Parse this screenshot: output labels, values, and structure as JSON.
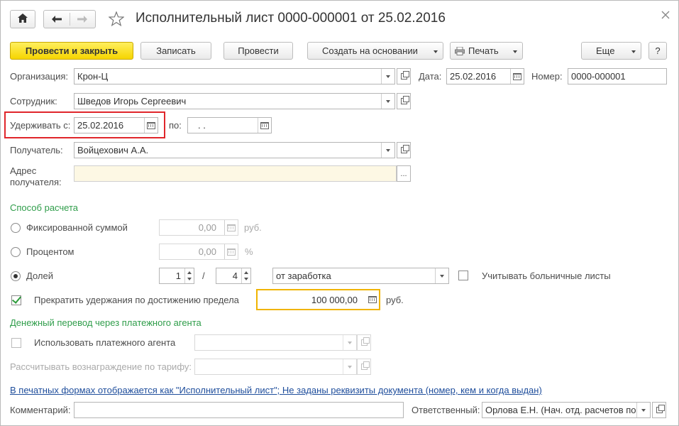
{
  "window": {
    "title": "Исполнительный лист 0000-000001 от 25.02.2016"
  },
  "toolbar": {
    "post_close": "Провести и закрыть",
    "save": "Записать",
    "post": "Провести",
    "create_based": "Создать на основании",
    "print": "Печать",
    "more": "Еще",
    "help": "?"
  },
  "form": {
    "organization": {
      "label": "Организация:",
      "value": "Крон-Ц"
    },
    "date": {
      "label": "Дата:",
      "value": "25.02.2016"
    },
    "number": {
      "label": "Номер:",
      "value": "0000-000001"
    },
    "employee": {
      "label": "Сотрудник:",
      "value": "Шведов Игорь Сергеевич"
    },
    "withhold_from": {
      "label": "Удерживать с:",
      "value": "25.02.2016"
    },
    "withhold_to": {
      "label": "по:",
      "value": " .  ."
    },
    "recipient": {
      "label": "Получатель:",
      "value": "Войцехович А.А."
    },
    "recipient_address": {
      "label_line1": "Адрес",
      "label_line2": "получателя:",
      "value": "",
      "button": "..."
    }
  },
  "calc": {
    "section_title": "Способ расчета",
    "fixed": {
      "label": "Фиксированной суммой",
      "value": "0,00",
      "unit": "руб.",
      "selected": false
    },
    "percent": {
      "label": "Процентом",
      "value": "0,00",
      "unit": "%",
      "selected": false
    },
    "share": {
      "label": "Долей",
      "numerator": "1",
      "separator": "/",
      "denominator": "4",
      "base": "от заработка",
      "selected": true
    },
    "sick_leave": {
      "label": "Учитывать больничные листы",
      "checked": false
    },
    "limit": {
      "label": "Прекратить удержания по достижению предела",
      "checked": true,
      "value": "100 000,00",
      "unit": "руб."
    }
  },
  "agent": {
    "section_title": "Денежный перевод через платежного агента",
    "use_agent": {
      "label": "Использовать платежного агента",
      "checked": false,
      "value": ""
    },
    "fee_tariff": {
      "label": "Рассчитывать вознаграждение по тарифу:",
      "value": ""
    }
  },
  "footer": {
    "print_link": "В печатных формах отображается как \"Исполнительный лист\"; Не заданы реквизиты документа (номер, кем и когда выдан)",
    "comment": {
      "label": "Комментарий:",
      "value": ""
    },
    "responsible": {
      "label": "Ответственный:",
      "value": "Орлова Е.Н. (Нач. отд. расчетов по"
    }
  },
  "colors": {
    "accent_primary": "#f6d500",
    "section_green": "#2f9d4a",
    "highlight_red": "#e0262b",
    "link_blue": "#1f4e9c",
    "active_field_border": "#f0b400"
  }
}
